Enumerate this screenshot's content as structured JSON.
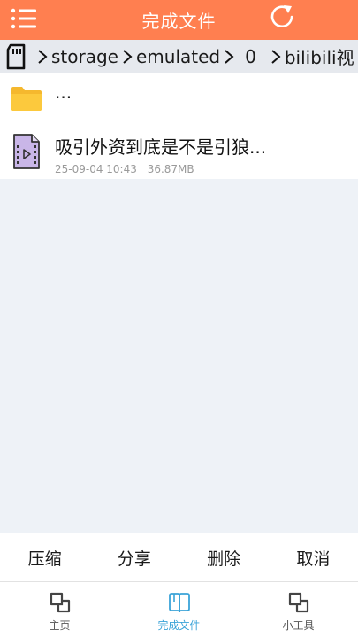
{
  "header": {
    "title": "完成文件",
    "bg_color": "#ff7f50",
    "menu_icon": "menu-icon",
    "refresh_icon": "refresh-icon"
  },
  "breadcrumb": {
    "root_icon": "sd-card-icon",
    "items": [
      "storage",
      "emulated",
      "0",
      "bilibili视"
    ]
  },
  "files": {
    "parent_label": "...",
    "items": [
      {
        "name": "吸引外资到底是不是引狼...",
        "date": "25-09-04 10:43",
        "size": "36.87MB",
        "icon": "video-file-icon"
      }
    ]
  },
  "actions": {
    "compress": "压缩",
    "share": "分享",
    "delete": "删除",
    "cancel": "取消"
  },
  "bottom_nav": {
    "active_color": "#3aa3d8",
    "items": [
      {
        "label": "主页",
        "icon": "home-icon"
      },
      {
        "label": "完成文件",
        "icon": "book-icon"
      },
      {
        "label": "小工具",
        "icon": "tools-icon"
      }
    ]
  }
}
